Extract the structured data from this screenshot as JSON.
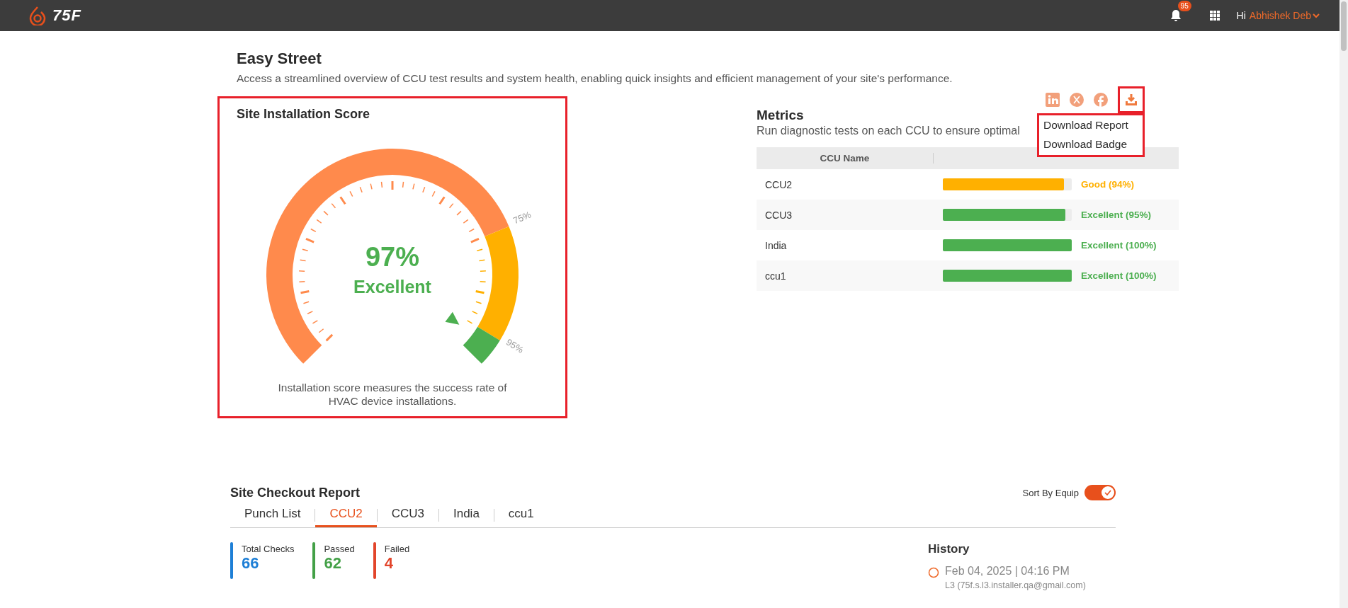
{
  "topbar": {
    "logo_text": "75F",
    "notifications": "95",
    "greeting": "Hi",
    "user": "Abhishek Deb"
  },
  "page": {
    "title": "Easy Street",
    "description": "Access a streamlined overview of CCU test results and system health, enabling quick insights and efficient management of your site's performance."
  },
  "installation_score": {
    "title": "Site Installation Score",
    "score": "97%",
    "rating": "Excellent",
    "band_labels": [
      "75%",
      "95%"
    ],
    "bands": [
      {
        "color": "#ff8a4c"
      },
      {
        "color": "#ffb000"
      },
      {
        "color": "#4caf50"
      }
    ],
    "caption": "Installation score measures the success rate of HVAC device installations."
  },
  "metrics": {
    "title": "Metrics",
    "subtitle": "Run diagnostic tests on each CCU to ensure optimal",
    "columns": [
      "CCU Name"
    ],
    "rows": [
      {
        "name": "CCU2",
        "level": 0.94,
        "score": "Good (94%)",
        "color": "#ffb000"
      },
      {
        "name": "CCU3",
        "level": 0.95,
        "score": "Excellent (95%)",
        "color": "#4caf50"
      },
      {
        "name": "India",
        "level": 1,
        "score": "Excellent (100%)",
        "color": "#4caf50"
      },
      {
        "name": "ccu1",
        "level": 1,
        "score": "Excellent (100%)",
        "color": "#4caf50"
      }
    ],
    "download_menu": [
      "Download Report",
      "Download Badge"
    ]
  },
  "checkout": {
    "title": "Site Checkout Report",
    "sort_label": "Sort By Equip",
    "sort_on": true,
    "tabs": [
      {
        "label": "Punch List",
        "selected": false
      },
      {
        "label": "CCU2",
        "selected": true
      },
      {
        "label": "CCU3",
        "selected": false
      },
      {
        "label": "India",
        "selected": false
      },
      {
        "label": "ccu1",
        "selected": false
      }
    ],
    "stats": [
      {
        "label": "Total Checks",
        "value": "66",
        "color": "#1e7fd6"
      },
      {
        "label": "Passed",
        "value": "62",
        "color": "#43a047"
      },
      {
        "label": "Failed",
        "value": "4",
        "color": "#e2452b"
      }
    ],
    "history": {
      "title": "History",
      "entries": [
        {
          "time": "Feb 04, 2025 | 04:16 PM",
          "user": "L3 (75f.s.l3.installer.qa@gmail.com)"
        }
      ]
    }
  }
}
